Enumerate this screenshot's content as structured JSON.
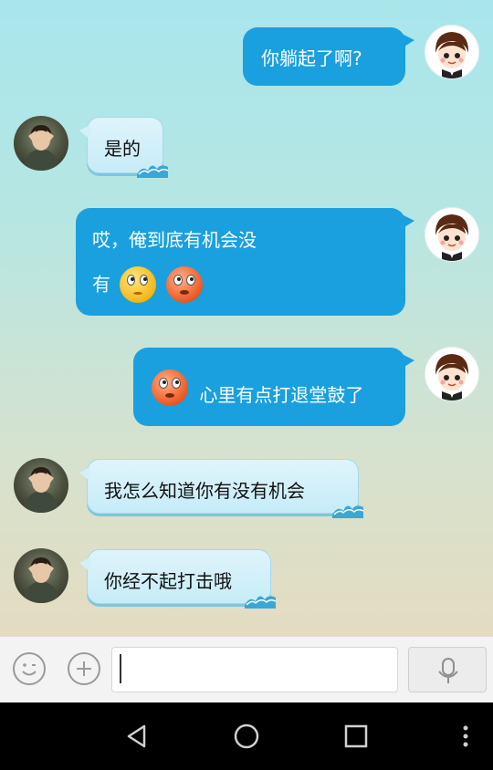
{
  "messages": [
    {
      "side": "out",
      "text": "你躺起了啊?"
    },
    {
      "side": "in",
      "text": "是的"
    },
    {
      "side": "out",
      "line1": "哎，俺到底有机会没",
      "line2": "有",
      "emojis": [
        "yellow-worried-emoji",
        "red-rolling-eyes-emoji"
      ]
    },
    {
      "side": "out",
      "text": "心里有点打退堂鼓了",
      "emojis": [
        "red-rolling-eyes-emoji"
      ]
    },
    {
      "side": "in",
      "text": "我怎么知道你有没有机会"
    },
    {
      "side": "in",
      "text": "你经不起打击哦"
    }
  ],
  "input_bar": {
    "icons": [
      "smiley-icon",
      "plus-icon",
      "microphone-icon"
    ],
    "input_value": "",
    "input_placeholder": ""
  },
  "navbar": {
    "icons": [
      "back-triangle-icon",
      "home-circle-icon",
      "recents-square-icon",
      "more-vertical-icon"
    ]
  },
  "colors": {
    "outgoing_bubble": "#1aa0de",
    "incoming_bubble": "#d3f0f9",
    "navbar": "#000000"
  }
}
